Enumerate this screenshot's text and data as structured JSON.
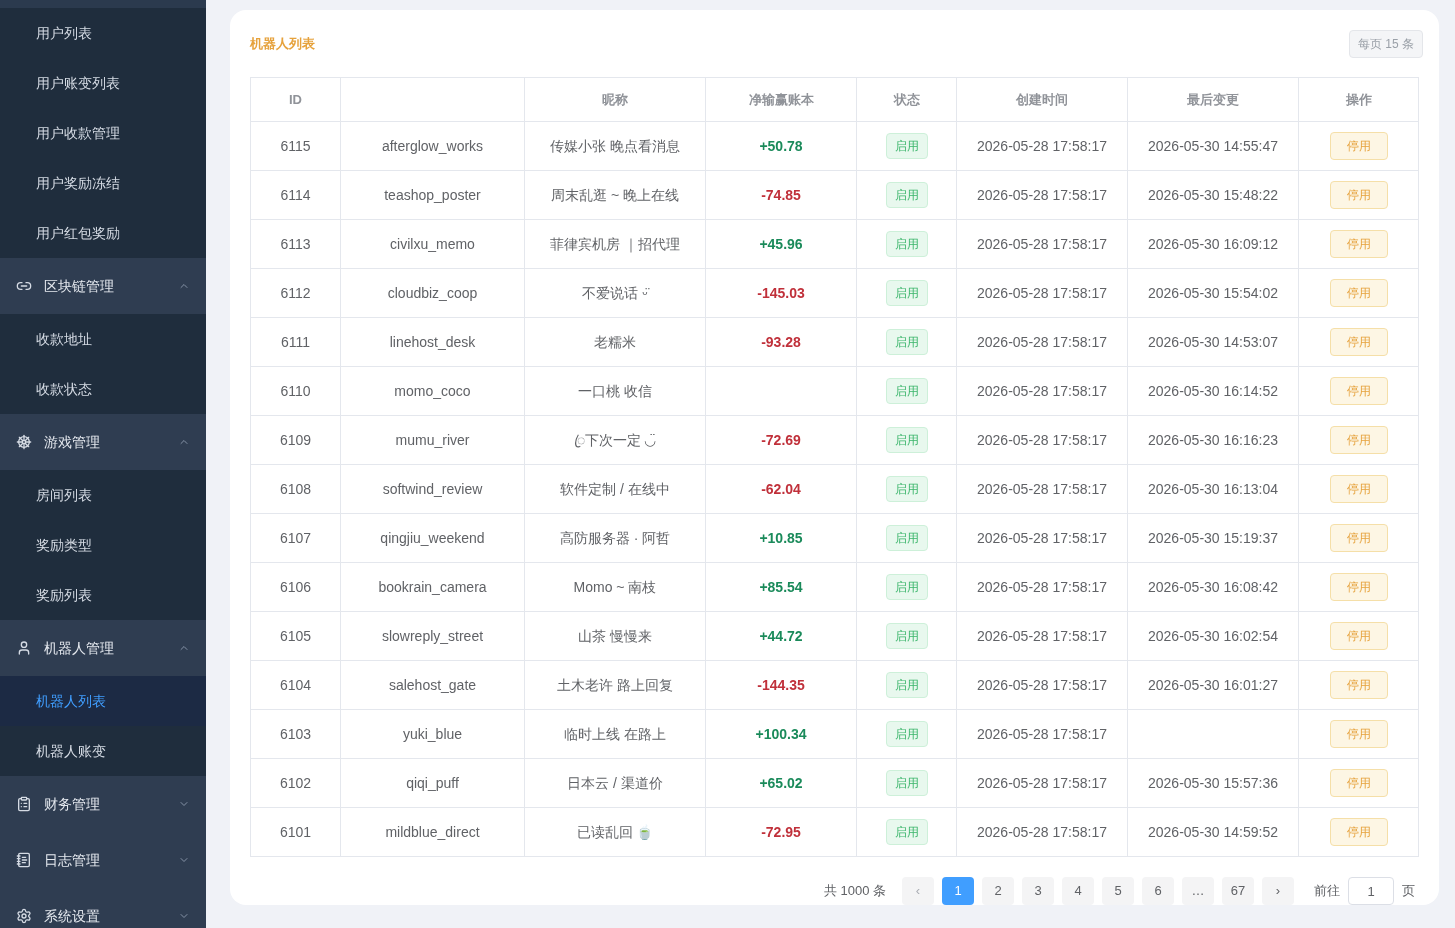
{
  "sidebar": {
    "menu": [
      {
        "kind": "item",
        "label": "用户列表",
        "selected": false
      },
      {
        "kind": "item",
        "label": "用户账变列表",
        "selected": false
      },
      {
        "kind": "item",
        "label": "用户收款管理",
        "selected": false
      },
      {
        "kind": "item",
        "label": "用户奖励冻结",
        "selected": false
      },
      {
        "kind": "item",
        "label": "用户红包奖励",
        "selected": false
      },
      {
        "kind": "group",
        "label": "区块链管理",
        "expanded": true,
        "children": [
          {
            "label": "收款地址",
            "selected": false
          },
          {
            "label": "收款状态",
            "selected": false
          }
        ]
      },
      {
        "kind": "group",
        "label": "游戏管理",
        "expanded": true,
        "children": [
          {
            "label": "房间列表",
            "selected": false
          },
          {
            "label": "奖励类型",
            "selected": false
          },
          {
            "label": "奖励列表",
            "selected": false
          }
        ]
      },
      {
        "kind": "group",
        "label": "机器人管理",
        "expanded": true,
        "children": [
          {
            "label": "机器人列表",
            "selected": true
          },
          {
            "label": "机器人账变",
            "selected": false
          }
        ]
      },
      {
        "kind": "group",
        "label": "财务管理",
        "expanded": false
      },
      {
        "kind": "group",
        "label": "日志管理",
        "expanded": false
      },
      {
        "kind": "group",
        "label": "系统设置",
        "expanded": false
      }
    ]
  },
  "card": {
    "title": "机器人列表",
    "page_size_badge": "每页 15 条"
  },
  "table": {
    "columns": [
      "ID",
      "",
      "昵称",
      "净输赢账本",
      "状态",
      "创建时间",
      "最后变更",
      "操作"
    ],
    "rows": [
      {
        "id": "6115",
        "username": "afterglow_works",
        "nickname": "传媒小张 晚点看消息",
        "net": "+50.78",
        "positive": true,
        "status": "启用",
        "created": "2026-05-28 17:58:17",
        "changed": "2026-05-30 14:55:47",
        "action": "停用"
      },
      {
        "id": "6114",
        "username": "teashop_poster",
        "nickname": "周末乱逛 ~ 晚上在线",
        "net": "-74.85",
        "positive": false,
        "status": "启用",
        "created": "2026-05-28 17:58:17",
        "changed": "2026-05-30 15:48:22",
        "action": "停用"
      },
      {
        "id": "6113",
        "username": "civilxu_memo",
        "nickname": "菲律宾机房 ｜招代理",
        "net": "+45.96",
        "positive": true,
        "status": "启用",
        "created": "2026-05-28 17:58:17",
        "changed": "2026-05-30 16:09:12",
        "action": "停用"
      },
      {
        "id": "6112",
        "username": "cloudbiz_coop",
        "nickname": "不爱说话 ᵕ̈",
        "net": "-145.03",
        "positive": false,
        "status": "启用",
        "created": "2026-05-28 17:58:17",
        "changed": "2026-05-30 15:54:02",
        "action": "停用"
      },
      {
        "id": "6111",
        "username": "linehost_desk",
        "nickname": "老糯米",
        "net": "-93.28",
        "positive": false,
        "status": "启用",
        "created": "2026-05-28 17:58:17",
        "changed": "2026-05-30 14:53:07",
        "action": "停用"
      },
      {
        "id": "6110",
        "username": "momo_coco",
        "nickname": "一口桃 收信",
        "status": "启用",
        "created": "2026-05-28 17:58:17",
        "changed": "2026-05-30 16:14:52",
        "action": "停用"
      },
      {
        "id": "6109",
        "username": "mumu_river",
        "nickname": "ꦿ下次一定 ◡̈",
        "net": "-72.69",
        "positive": false,
        "status": "启用",
        "created": "2026-05-28 17:58:17",
        "changed": "2026-05-30 16:16:23",
        "action": "停用"
      },
      {
        "id": "6108",
        "username": "softwind_review",
        "nickname": "软件定制 / 在线中",
        "net": "-62.04",
        "positive": false,
        "status": "启用",
        "created": "2026-05-28 17:58:17",
        "changed": "2026-05-30 16:13:04",
        "action": "停用"
      },
      {
        "id": "6107",
        "username": "qingjiu_weekend",
        "nickname": "高防服务器 · 阿哲",
        "net": "+10.85",
        "positive": true,
        "status": "启用",
        "created": "2026-05-28 17:58:17",
        "changed": "2026-05-30 15:19:37",
        "action": "停用"
      },
      {
        "id": "6106",
        "username": "bookrain_camera",
        "nickname": "Momo ~ 南枝",
        "net": "+85.54",
        "positive": true,
        "status": "启用",
        "created": "2026-05-28 17:58:17",
        "changed": "2026-05-30 16:08:42",
        "action": "停用"
      },
      {
        "id": "6105",
        "username": "slowreply_street",
        "nickname": "山茶 慢慢来",
        "net": "+44.72",
        "positive": true,
        "status": "启用",
        "created": "2026-05-28 17:58:17",
        "changed": "2026-05-30 16:02:54",
        "action": "停用"
      },
      {
        "id": "6104",
        "username": "salehost_gate",
        "nickname": "土木老许 路上回复",
        "net": "-144.35",
        "positive": false,
        "status": "启用",
        "created": "2026-05-28 17:58:17",
        "changed": "2026-05-30 16:01:27",
        "action": "停用"
      },
      {
        "id": "6103",
        "username": "yuki_blue",
        "nickname": "临时上线 在路上",
        "net": "+100.34",
        "positive": true,
        "status": "启用",
        "created": "2026-05-28 17:58:17",
        "action": "停用"
      },
      {
        "id": "6102",
        "username": "qiqi_puff",
        "nickname": "日本云 / 渠道价",
        "net": "+65.02",
        "positive": true,
        "status": "启用",
        "created": "2026-05-28 17:58:17",
        "changed": "2026-05-30 15:57:36",
        "action": "停用"
      },
      {
        "id": "6101",
        "username": "mildblue_direct",
        "nickname": "已读乱回 🍵",
        "net": "-72.95",
        "positive": false,
        "status": "启用",
        "created": "2026-05-28 17:58:17",
        "changed": "2026-05-30 14:59:52",
        "action": "停用"
      }
    ]
  },
  "pagination": {
    "total": "共 1000 条",
    "prev": "‹",
    "pages": [
      {
        "label": "1",
        "selected": true
      },
      {
        "label": "2",
        "selected": false
      },
      {
        "label": "3",
        "selected": false
      },
      {
        "label": "4",
        "selected": false
      },
      {
        "label": "5",
        "selected": false
      },
      {
        "label": "6",
        "selected": false
      },
      {
        "label": "…",
        "selected": false
      },
      {
        "label": "67",
        "selected": false
      }
    ],
    "next": "›",
    "goto_label": "前往",
    "goto_value": "1",
    "page_unit": "页"
  }
}
